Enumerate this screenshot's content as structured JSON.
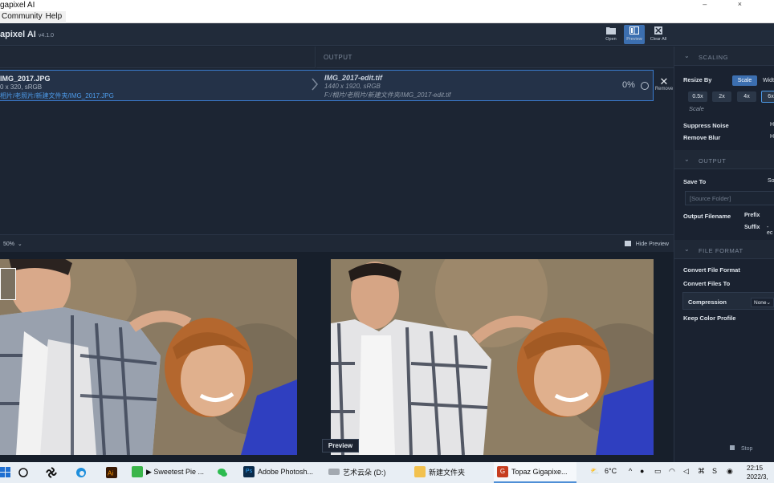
{
  "window": {
    "title": "gapixel AI",
    "controls": "– ×"
  },
  "menu": {
    "items": [
      "Community",
      "Help"
    ]
  },
  "app": {
    "name": "apixel AI",
    "version": "v4.1.0"
  },
  "toolbar": {
    "open": "Open",
    "preview": "Preview",
    "clear_all": "Clear All"
  },
  "columns": {
    "output": "OUTPUT"
  },
  "file": {
    "input_name": "IMG_2017.JPG",
    "input_dims": "0 x 320, sRGB",
    "input_path": "相片/老照片/新建文件夹/IMG_2017.JPG",
    "output_name": "IMG_2017-edit.tif",
    "output_dims": "1440 x 1920, sRGB",
    "output_path": "F:/相片/老照片/新建文件夹/IMG_2017-edit.tif",
    "progress_label": "0%",
    "progress": 0,
    "remove": "Remove"
  },
  "preview_bar": {
    "zoom": "50%",
    "hide": "Hide Preview",
    "label": "Preview"
  },
  "panel": {
    "scaling": "SCALING",
    "resize_by": "Resize By",
    "scale_btn": "Scale",
    "width_btn": "Widt",
    "scales": [
      "0.5x",
      "2x",
      "4x",
      "6x"
    ],
    "scale_label": "Scale",
    "suppress_noise": "Suppress Noise",
    "suppress_val": "H",
    "remove_blur": "Remove Blur",
    "blur_val": "H",
    "output": "OUTPUT",
    "save_to": "Save To",
    "save_val": "So",
    "source_folder": "[Source Folder]",
    "output_filename": "Output Filename",
    "prefix": "Prefix",
    "suffix": "Suffix",
    "suffix_val": "-ec",
    "file_format": "FILE FORMAT",
    "convert_format": "Convert File Format",
    "convert_to": "Convert Files To",
    "compression": "Compression",
    "compression_val": "None",
    "keep_profile": "Keep Color Profile",
    "stop": "Stop"
  },
  "taskbar": {
    "items": [
      "▶ Sweetest Pie ...",
      "Adobe Photosh...",
      "艺术云朵 (D:)",
      "新建文件夹",
      "Topaz Gigapixe..."
    ],
    "weather": "6°C",
    "time": "22:15",
    "date": "2022/3,"
  }
}
